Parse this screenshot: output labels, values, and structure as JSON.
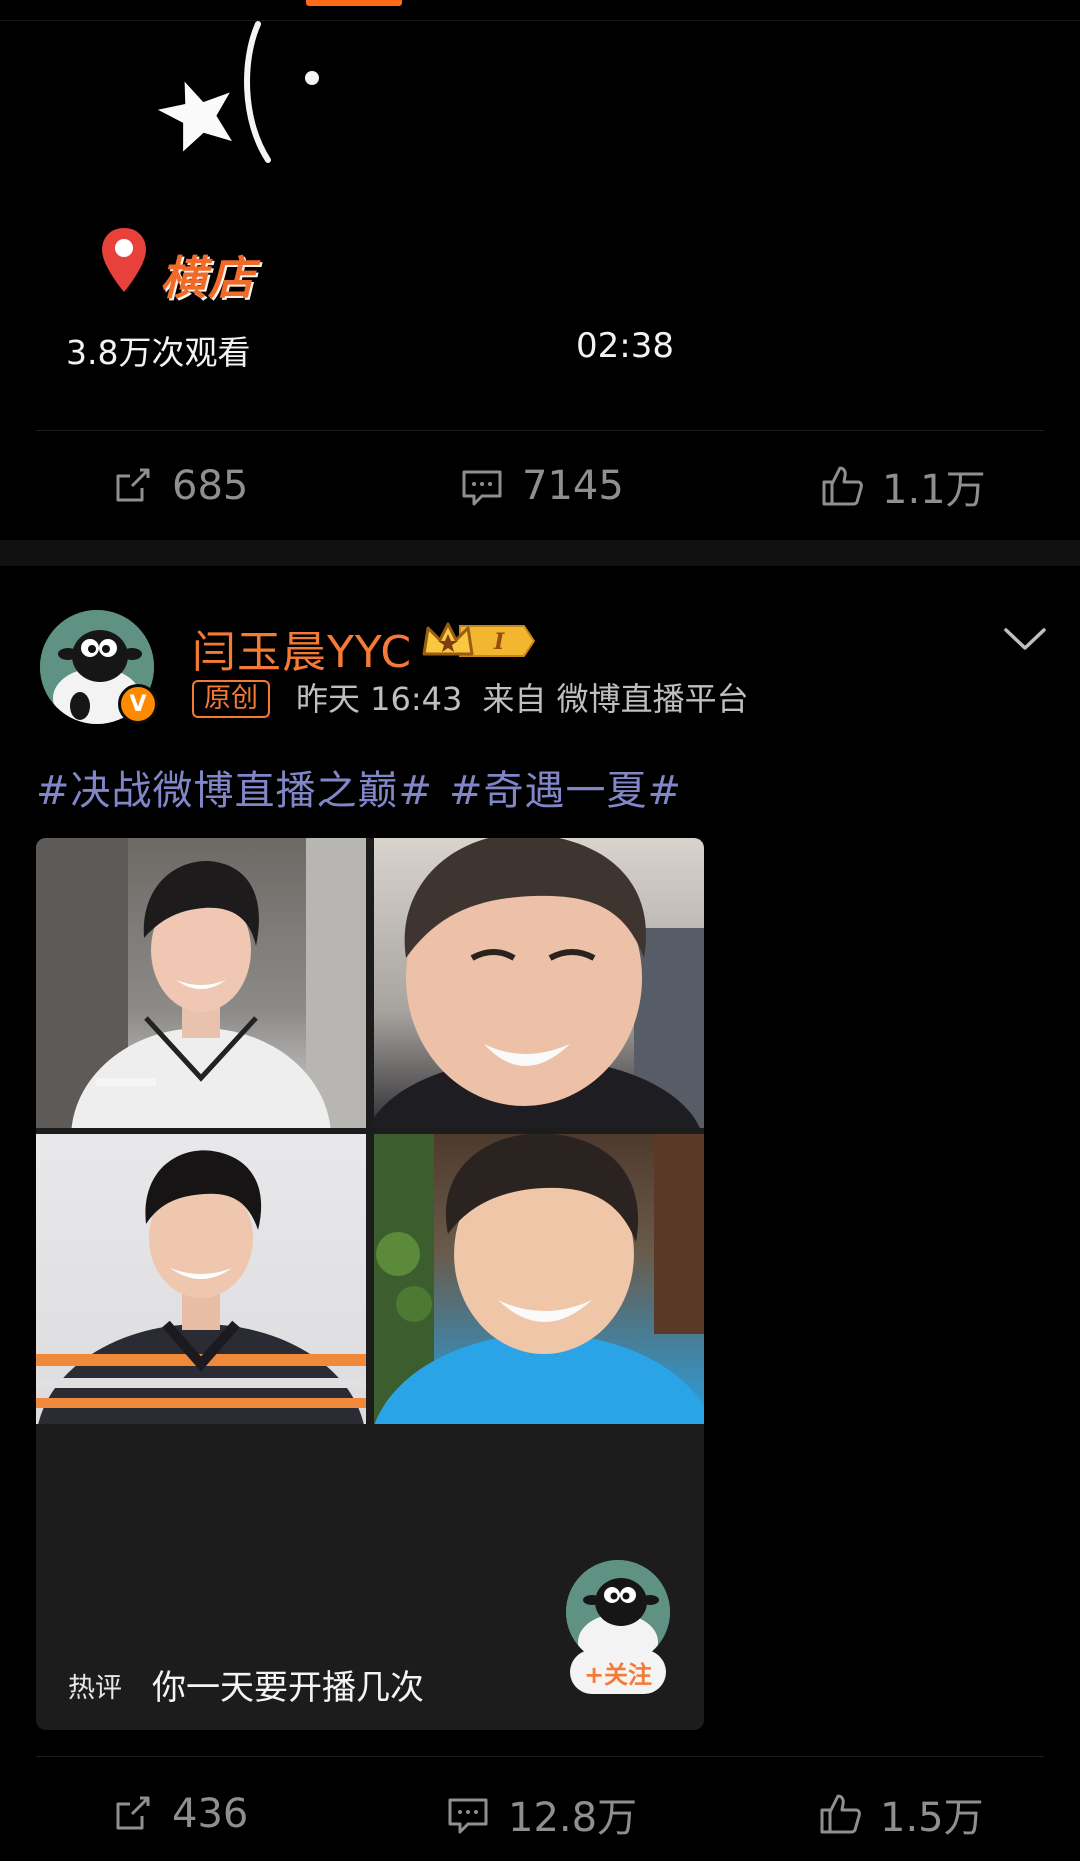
{
  "top_post": {
    "location": "横店",
    "views": "3.8万次观看",
    "duration": "02:38",
    "actions": {
      "repost_count": "685",
      "comment_count": "7145",
      "like_count": "1.1万"
    }
  },
  "post": {
    "username": "闫玉晨YYC",
    "vip_level": "I",
    "verified_mark": "V",
    "original_tag": "原创",
    "time": "昨天 16:43",
    "source": "来自 微博直播平台",
    "hashtags": [
      "#决战微博直播之巅#",
      "#奇遇一夏#"
    ],
    "hot_comment": {
      "label": "热评",
      "text": "你一天要开播几次"
    },
    "follow_label": "+关注",
    "actions": {
      "repost_count": "436",
      "comment_count": "12.8万",
      "like_count": "1.5万"
    }
  },
  "colors": {
    "accent": "#f47a35",
    "hashtag": "#8086c8",
    "icon": "#8f8f8f",
    "background": "#000000"
  },
  "icons": [
    "repost-icon",
    "comment-icon",
    "like-icon",
    "chevron-down-icon",
    "location-pin-icon",
    "vip-crown-icon"
  ]
}
